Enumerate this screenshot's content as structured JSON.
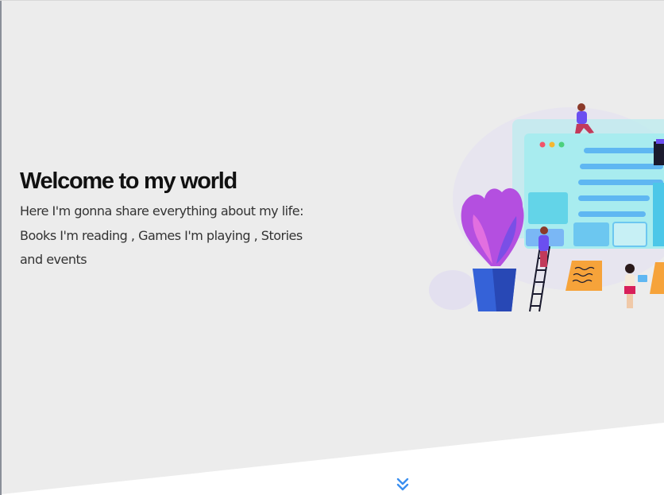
{
  "hero": {
    "title": "Welcome to my world",
    "subtitle": "Here I'm gonna share everything about my life: Books I'm reading , Games I'm playing , Stories and events"
  },
  "colors": {
    "hero_background": "#ececec",
    "title_text": "#111111",
    "body_text": "#333333",
    "accent_blue": "#3b8ff0"
  },
  "icons": {
    "scroll_down": "double-chevron-down-icon"
  }
}
